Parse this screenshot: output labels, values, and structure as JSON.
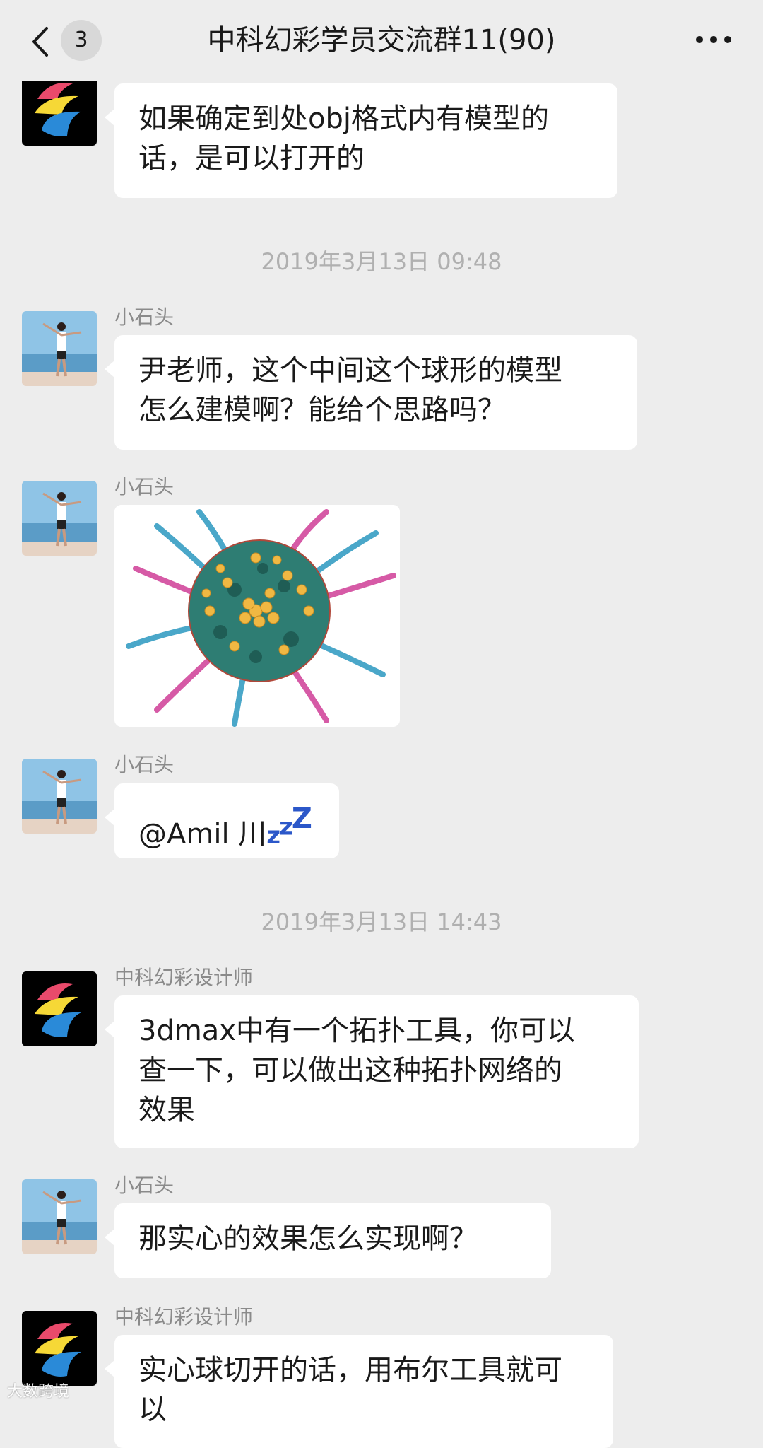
{
  "header": {
    "back_icon": "chevron-left-icon",
    "unread_count": "3",
    "title": "中科幻彩学员交流群11(90)",
    "more_icon": "more-dots-icon"
  },
  "messages": [
    {
      "sender": "",
      "text_lines": [
        "如果确定到处obj格式内有模型的",
        "话，是可以打开的"
      ]
    },
    {
      "timestamp": "2019年3月13日 09:48"
    },
    {
      "sender": "小石头",
      "text_lines": [
        "尹老师，这个中间这个球形的模型",
        "怎么建模啊？能给个思路吗？"
      ]
    },
    {
      "sender": "小石头",
      "image": "sphere-model-image"
    },
    {
      "sender": "小石头",
      "text": "@Amil 川",
      "emoji": "zzz"
    },
    {
      "timestamp": "2019年3月13日 14:43"
    },
    {
      "sender": "中科幻彩设计师",
      "text_lines": [
        "3dmax中有一个拓扑工具，你可以",
        "查一下，可以做出这种拓扑网络的",
        "效果"
      ]
    },
    {
      "sender": "小石头",
      "text": "那实心的效果怎么实现啊？"
    },
    {
      "sender": "中科幻彩设计师",
      "text_lines": [
        "实心球切开的话，用布尔工具就可",
        "以"
      ]
    }
  ],
  "watermark": "大数跨境",
  "colors": {
    "background": "#ededed",
    "bubble": "#ffffff",
    "zzz": "#2b57c9"
  }
}
